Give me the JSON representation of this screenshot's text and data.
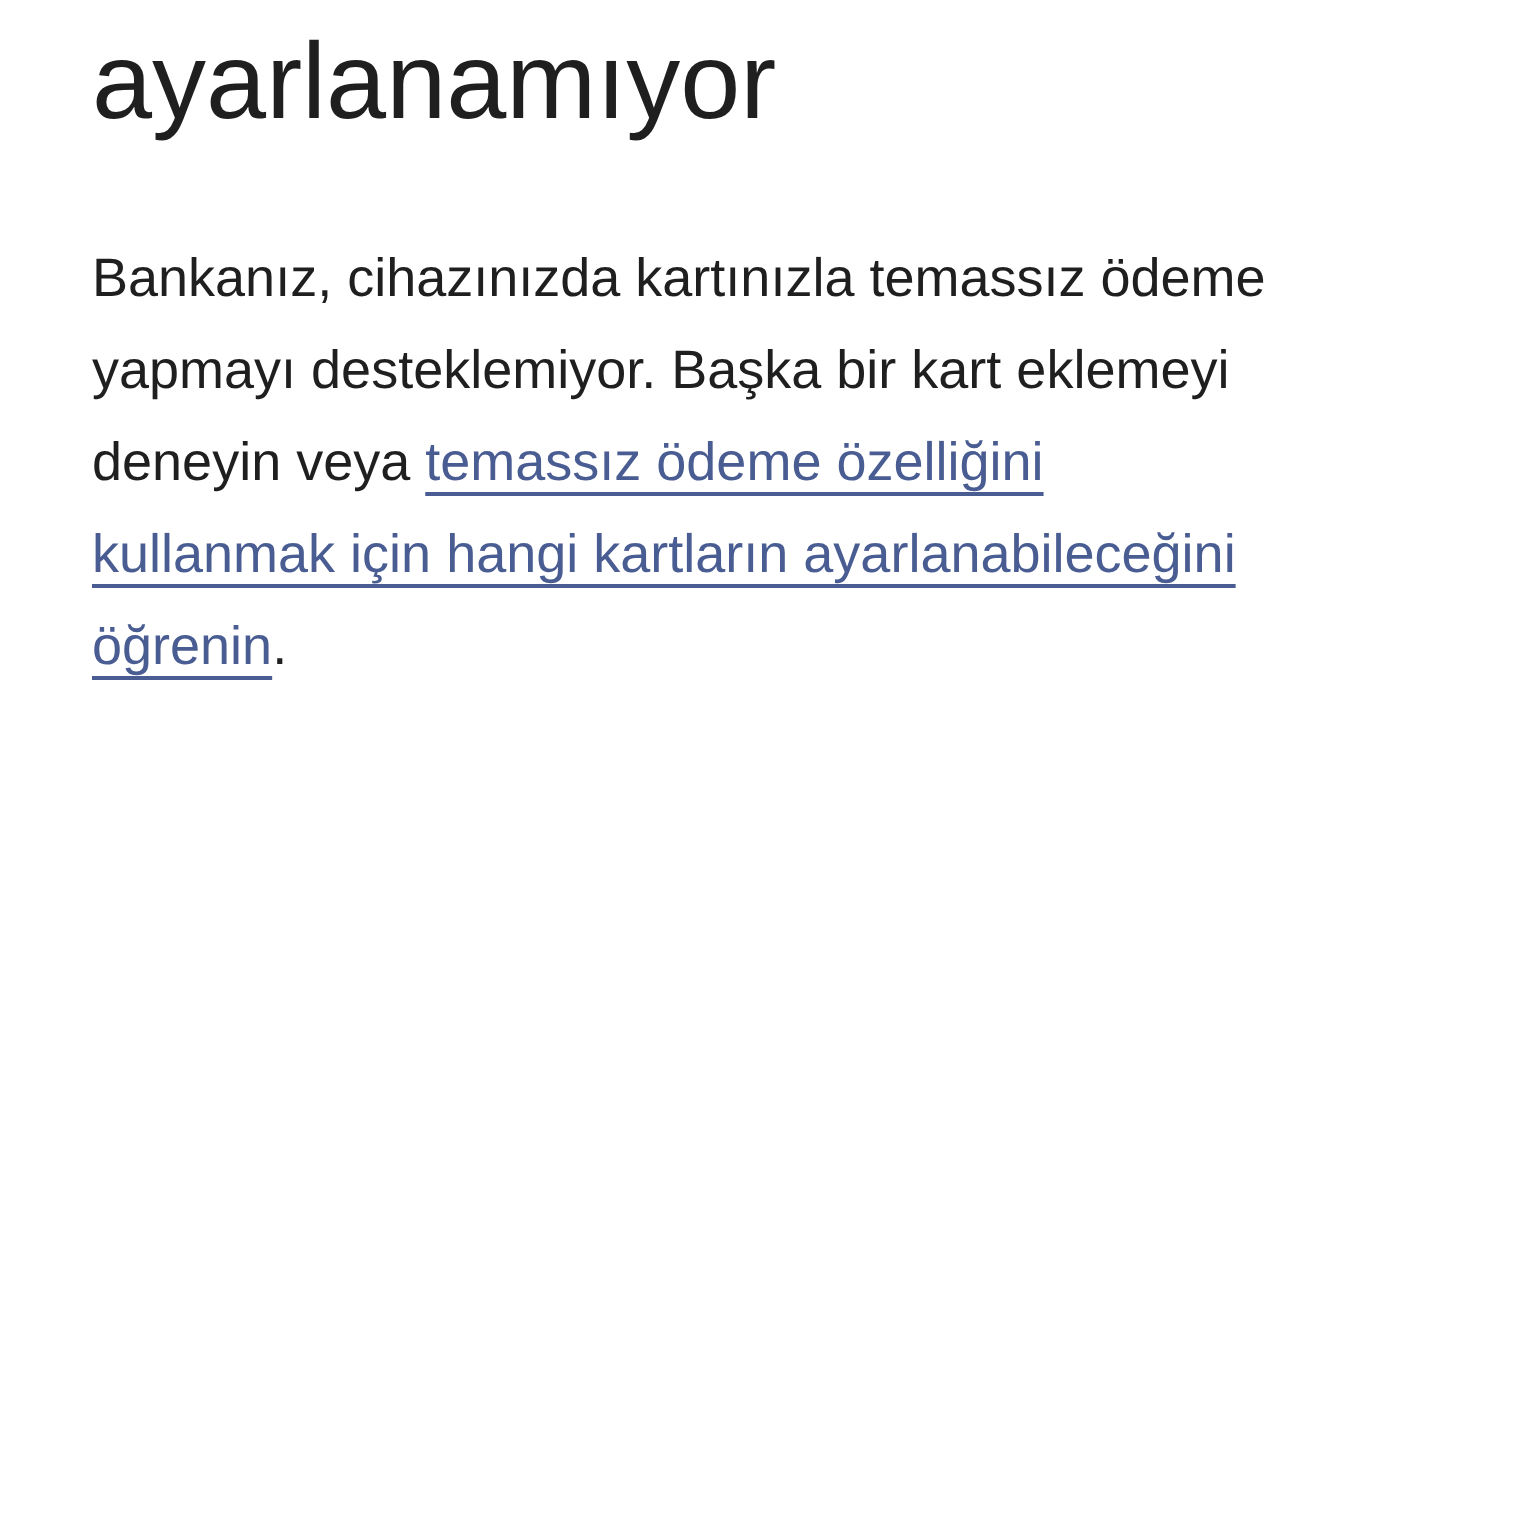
{
  "title": "ayarlanamıyor",
  "message": {
    "text": "Bankanız, cihazınızda kartınızla temassız ödeme yapmayı desteklemiyor. Başka bir kart eklemeyi deneyin veya ",
    "link_lines": [
      "temassız ödeme özelliğini",
      "kullanmak için hangi kartların ayarlanabileceğini",
      "öğrenin"
    ],
    "after": "."
  }
}
